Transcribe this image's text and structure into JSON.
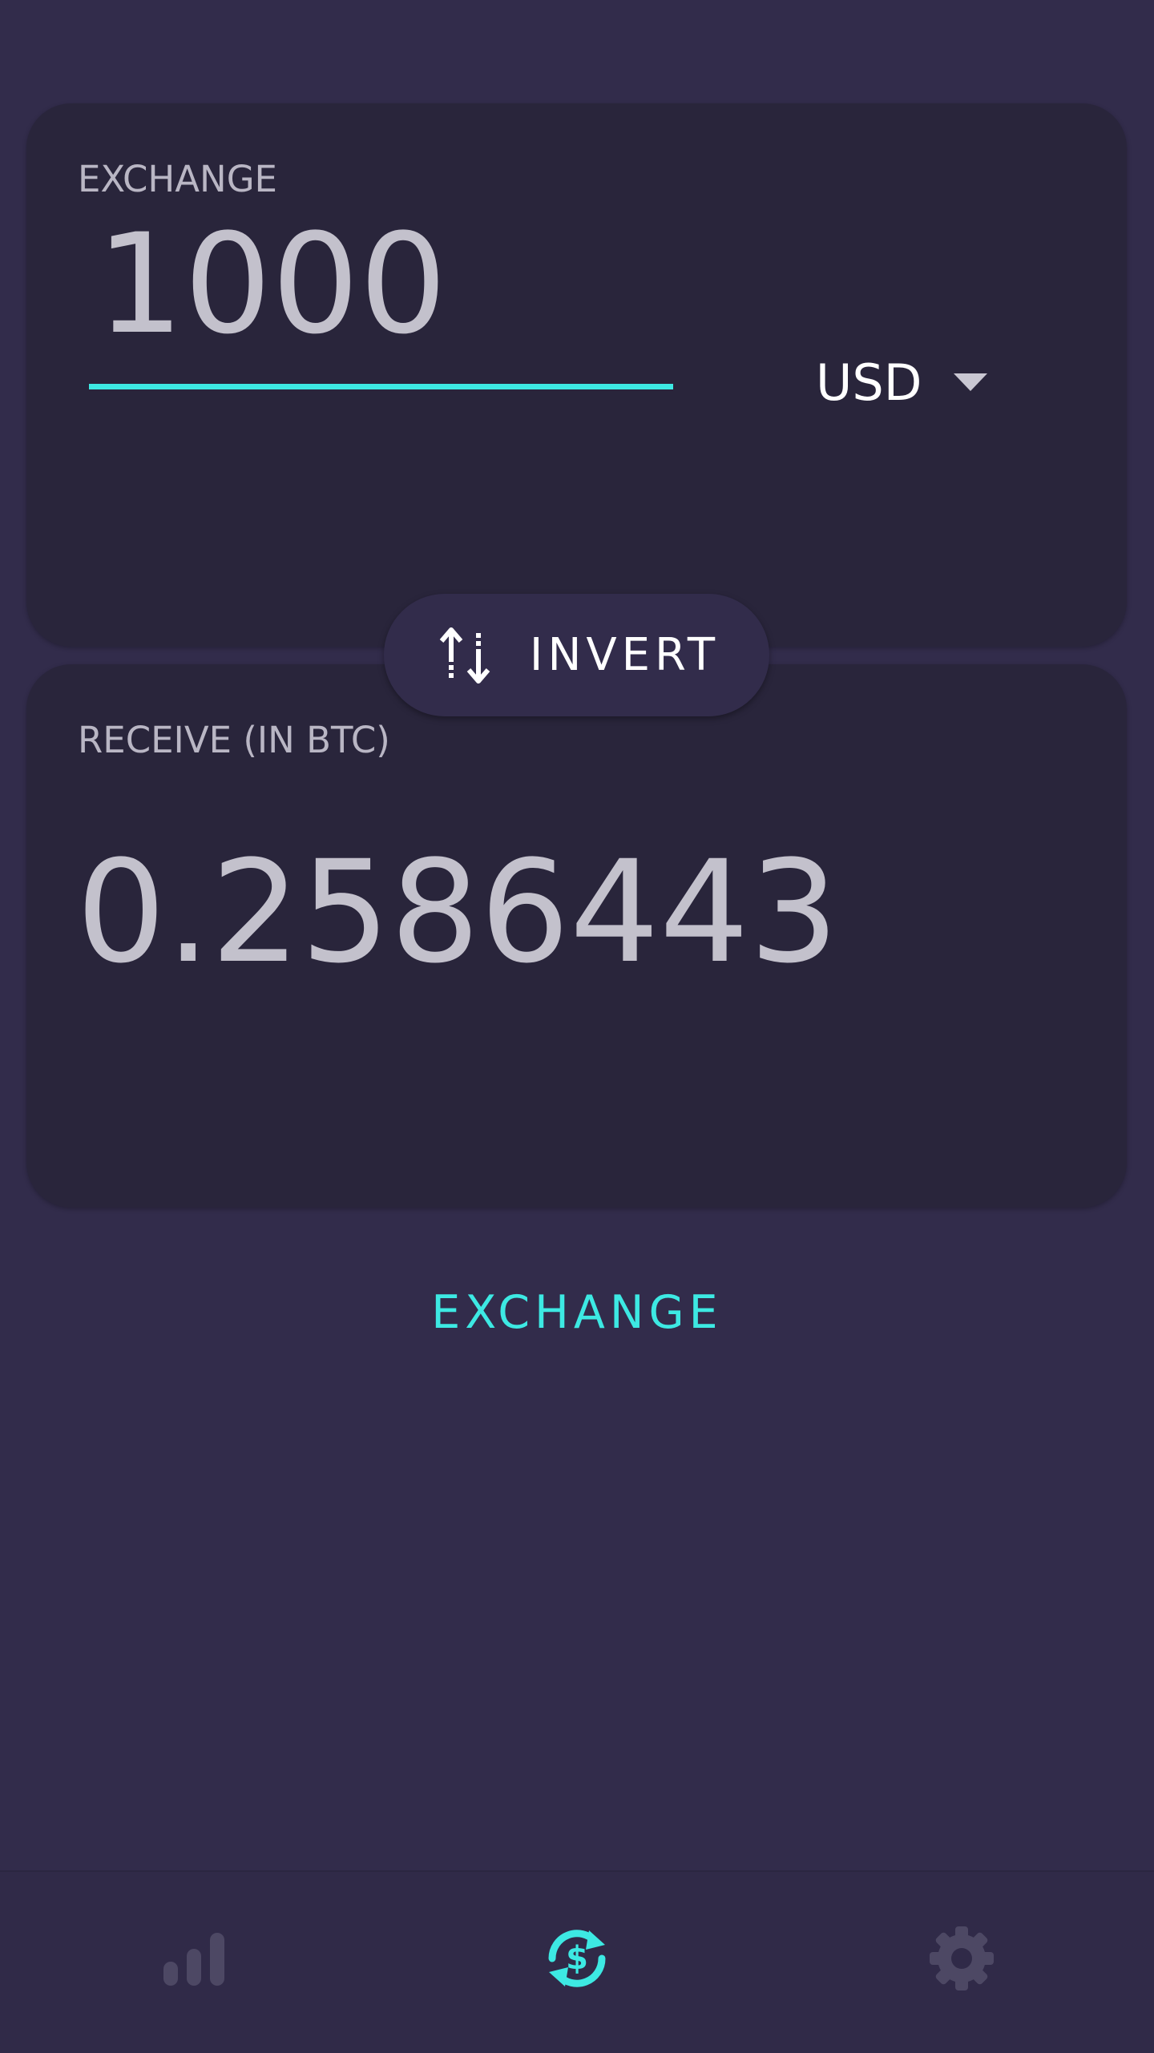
{
  "exchange_card": {
    "label": "EXCHANGE",
    "amount": "1000",
    "currency": "USD"
  },
  "invert_button": {
    "label": "INVERT",
    "icon": "swap-vertical-icon"
  },
  "receive_card": {
    "label": "RECEIVE (IN BTC)",
    "value": "0.2586443"
  },
  "exchange_button": {
    "label": "EXCHANGE"
  },
  "bottom_nav": {
    "items": [
      {
        "icon": "bar-chart-icon",
        "active": false
      },
      {
        "icon": "currency-exchange-icon",
        "active": true
      },
      {
        "icon": "gear-icon",
        "active": false
      }
    ]
  },
  "colors": {
    "background": "#322c4b",
    "card": "#29253b",
    "accent": "#3de9e3",
    "inactive_icon": "#4d4864"
  }
}
